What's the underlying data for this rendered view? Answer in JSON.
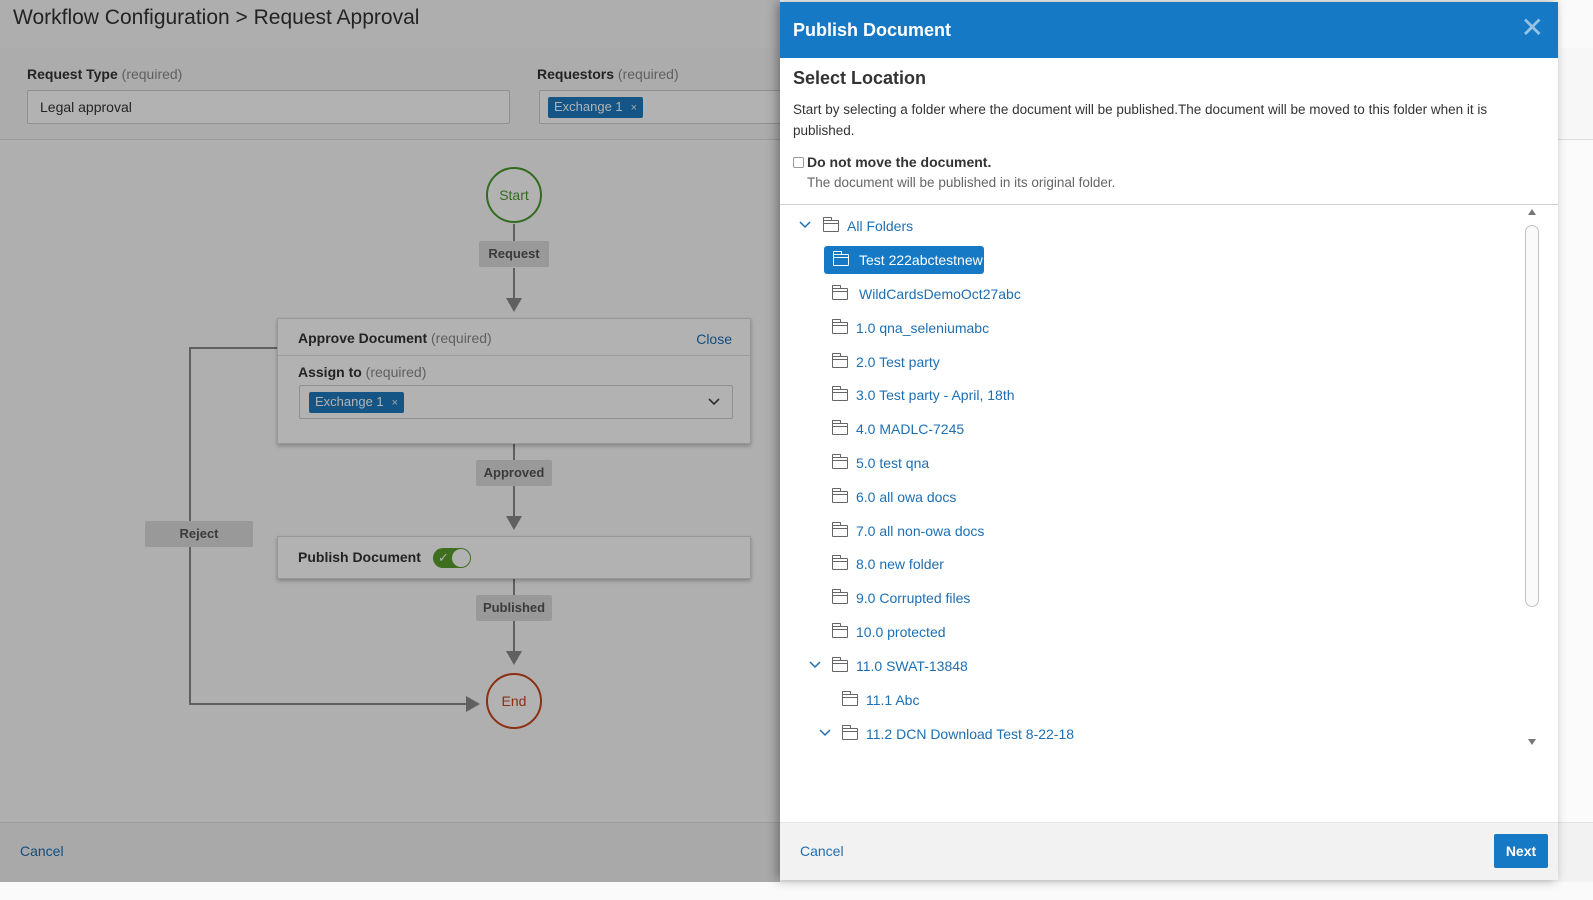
{
  "page": {
    "title": "Workflow Configuration > Request Approval",
    "request_type": {
      "label": "Request Type",
      "req": "(required)",
      "value": "Legal approval"
    },
    "requestors": {
      "label": "Requestors",
      "req": "(required)",
      "chip": "Exchange 1",
      "chip_remove": "×"
    },
    "cancel_label": "Cancel"
  },
  "flow": {
    "start": "Start",
    "end": "End",
    "request_tag": "Request",
    "approved_tag": "Approved",
    "reject_tag": "Reject",
    "published_tag": "Published",
    "approve_card": {
      "title": "Approve Document",
      "req": "(required)",
      "close": "Close",
      "assign_label": "Assign to",
      "assign_req": "(required)",
      "assign_chip": "Exchange 1",
      "chip_remove": "×",
      "dropdown_icon": "chevron-down-icon"
    },
    "publish_card": {
      "title": "Publish Document",
      "toggle_on": true,
      "toggle_check": "✓"
    }
  },
  "drawer": {
    "title": "Publish Document",
    "close_glyph": "✕",
    "section_title": "Select Location",
    "description": "Start by selecting a folder where the document will be published.The document will be moved to this folder when it is published.",
    "checkbox_label": "Do not move the document.",
    "checkbox_checked": false,
    "checkbox_note": "The document will be published in its original folder.",
    "tree": [
      {
        "label": "All Folders",
        "expanded": true,
        "chevron": "﹀"
      },
      {
        "label": "Test 222abctestnew",
        "selected": true
      },
      {
        "label": "WildCardsDemoOct27abc"
      },
      {
        "label": "1.0 qna_seleniumabc"
      },
      {
        "label": "2.0 Test party"
      },
      {
        "label": "3.0 Test party - April, 18th"
      },
      {
        "label": "4.0 MADLC-7245"
      },
      {
        "label": "5.0 test qna"
      },
      {
        "label": "6.0 all owa docs"
      },
      {
        "label": "7.0 all non-owa docs"
      },
      {
        "label": "8.0 new folder"
      },
      {
        "label": "9.0 Corrupted files"
      },
      {
        "label": "10.0 protected"
      },
      {
        "label": "11.0 SWAT-13848",
        "expanded": true,
        "chevron": "﹀"
      },
      {
        "label": "11.1 Abc"
      },
      {
        "label": "11.2 DCN Download Test 8-22-18",
        "expanded": true,
        "chevron": "﹀"
      }
    ],
    "footer": {
      "cancel_label": "Cancel",
      "next_label": "Next"
    },
    "accent_color": "#1679c5"
  }
}
